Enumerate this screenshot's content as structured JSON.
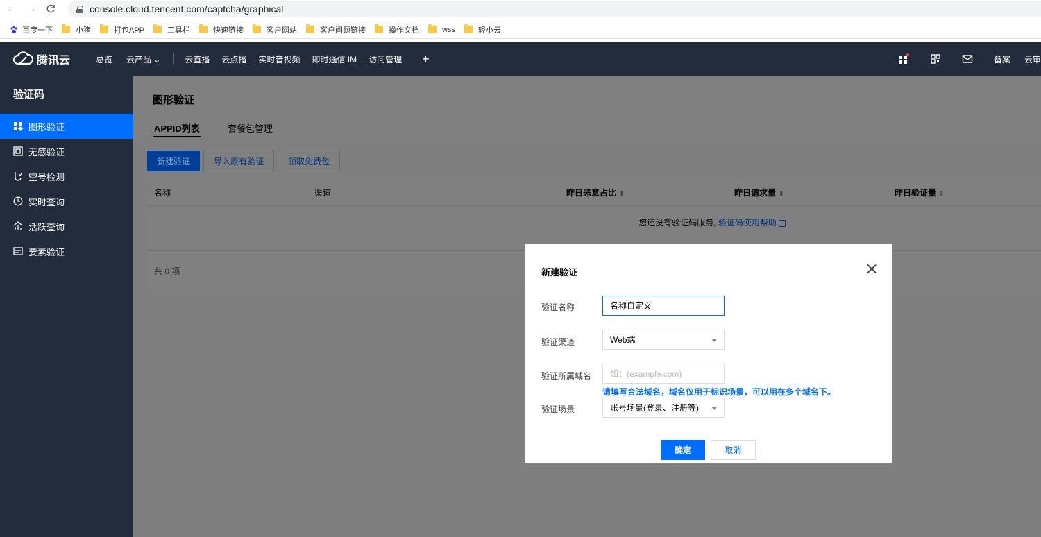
{
  "browser": {
    "url": "console.cloud.tencent.com/captcha/graphical",
    "bookmarks": [
      {
        "label": "百度一下",
        "icon": "baidu-paw-icon"
      },
      {
        "label": "小猪",
        "icon": "folder-icon"
      },
      {
        "label": "打包APP",
        "icon": "folder-icon"
      },
      {
        "label": "工具栏",
        "icon": "folder-icon"
      },
      {
        "label": "快速链接",
        "icon": "folder-icon"
      },
      {
        "label": "客户网站",
        "icon": "folder-icon"
      },
      {
        "label": "客户问题链接",
        "icon": "folder-icon"
      },
      {
        "label": "操作文档",
        "icon": "folder-icon"
      },
      {
        "label": "wss",
        "icon": "folder-icon"
      },
      {
        "label": "轻小云",
        "icon": "folder-icon"
      }
    ]
  },
  "topnav": {
    "brand": "腾讯云",
    "overview": "总览",
    "products": "云产品 ⌄",
    "links": [
      "云直播",
      "云点播",
      "实时音视频",
      "即时通信 IM",
      "访问管理"
    ],
    "plus": "+",
    "right_links": [
      "备案",
      "云审"
    ]
  },
  "sidebar": {
    "title": "验证码",
    "items": [
      {
        "label": "图形验证",
        "icon": "grid-icon",
        "active": true
      },
      {
        "label": "无感验证",
        "icon": "frame-icon",
        "active": false
      },
      {
        "label": "空号检测",
        "icon": "phone-check-icon",
        "active": false
      },
      {
        "label": "实时查询",
        "icon": "clock-icon",
        "active": false
      },
      {
        "label": "活跃查询",
        "icon": "activity-icon",
        "active": false
      },
      {
        "label": "要素验证",
        "icon": "card-icon",
        "active": false
      }
    ]
  },
  "main": {
    "title": "图形验证",
    "tabs": [
      "APPID列表",
      "套餐包管理"
    ],
    "buttons": {
      "create": "新建验证",
      "import": "导入原有验证",
      "free": "领取免费包"
    },
    "table": {
      "columns": [
        "名称",
        "渠道",
        "昨日恶意占比",
        "昨日请求量",
        "昨日验证量"
      ],
      "sort_glyph": "⇕",
      "empty_text": "您还没有验证码服务,",
      "empty_link": "验证码使用帮助",
      "total": "共 0 项"
    }
  },
  "modal": {
    "title": "新建验证",
    "fields": {
      "name_label": "验证名称",
      "name_value": "名称自定义",
      "channel_label": "验证渠道",
      "channel_value": "Web端",
      "domain_label": "验证所属域名",
      "domain_placeholder": "如：(example.com)",
      "domain_hint": "请填写合法域名，域名仅用于标识场景，可以用在多个域名下。",
      "scene_label": "验证场景",
      "scene_value": "账号场景(登录、注册等)"
    },
    "ok": "确定",
    "cancel": "取消"
  },
  "colors": {
    "nav_bg": "#222c3c",
    "accent": "#006eff",
    "overlay": "#7f7f7f"
  }
}
